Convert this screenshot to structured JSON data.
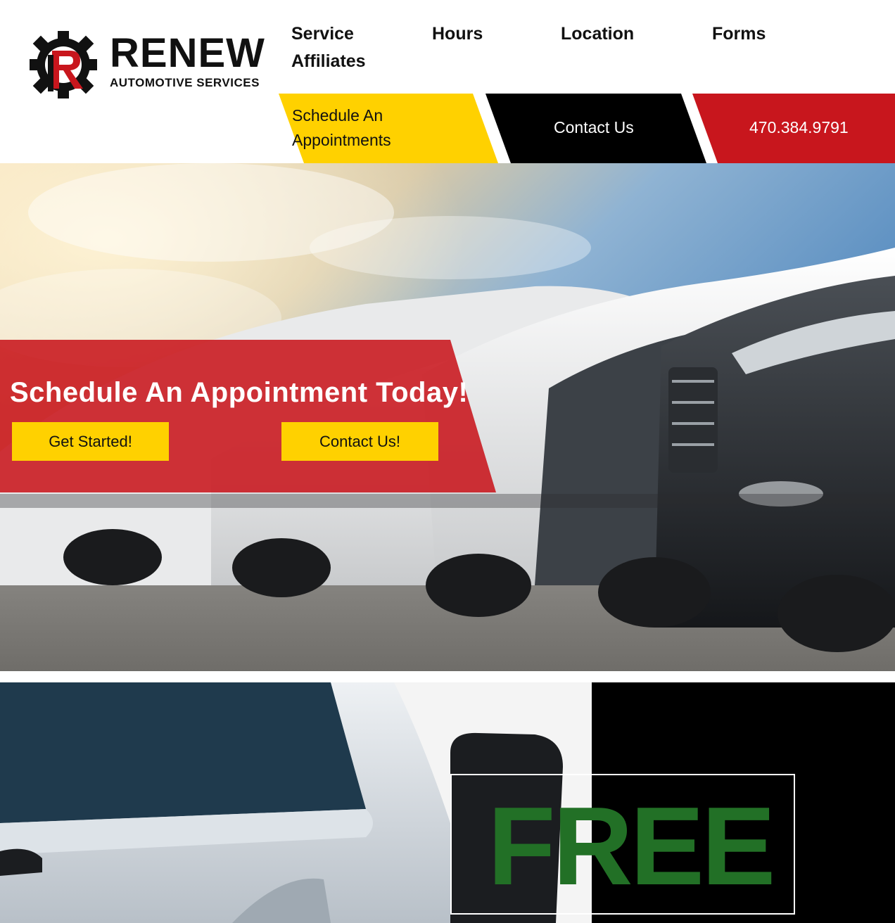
{
  "brand": {
    "name": "RENEW",
    "tagline": "AUTOMOTIVE SERVICES",
    "colors": {
      "red": "#c8161d",
      "yellow": "#ffd100",
      "black": "#000000",
      "green": "#227026"
    }
  },
  "nav": {
    "items": [
      {
        "label": "Service"
      },
      {
        "label": "Hours"
      },
      {
        "label": "Location"
      },
      {
        "label": "Forms"
      },
      {
        "label": "Affiliates"
      }
    ]
  },
  "cta": {
    "schedule_line1": "Schedule An",
    "schedule_line2": "Appointments",
    "contact": "Contact Us",
    "phone": "470.384.9791"
  },
  "hero": {
    "headline": "Schedule An Appointment Today!",
    "primary_button": "Get Started!",
    "secondary_button": "Contact Us!"
  },
  "promo": {
    "headline": "FREE"
  }
}
